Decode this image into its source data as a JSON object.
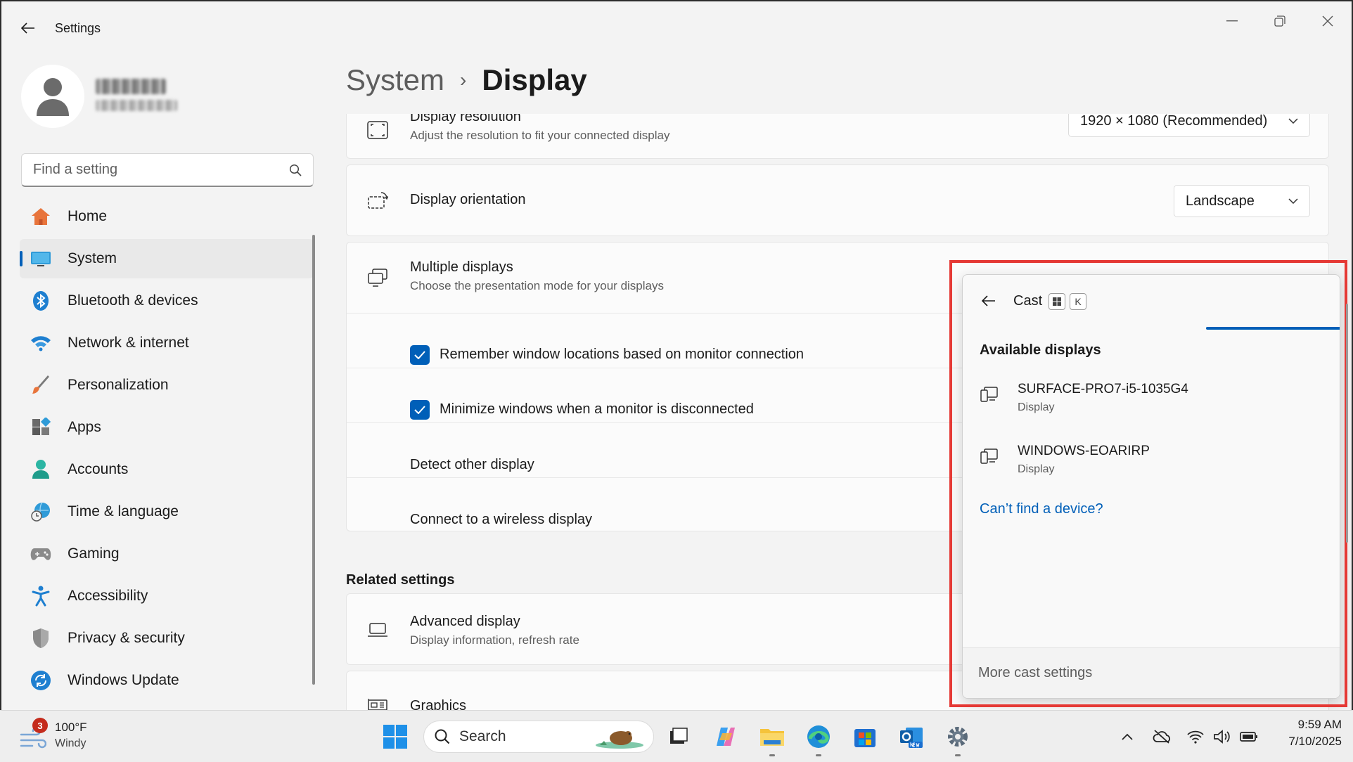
{
  "window": {
    "title": "Settings"
  },
  "search": {
    "placeholder": "Find a setting"
  },
  "nav": {
    "items": [
      {
        "label": "Home"
      },
      {
        "label": "System"
      },
      {
        "label": "Bluetooth & devices"
      },
      {
        "label": "Network & internet"
      },
      {
        "label": "Personalization"
      },
      {
        "label": "Apps"
      },
      {
        "label": "Accounts"
      },
      {
        "label": "Time & language"
      },
      {
        "label": "Gaming"
      },
      {
        "label": "Accessibility"
      },
      {
        "label": "Privacy & security"
      },
      {
        "label": "Windows Update"
      }
    ]
  },
  "breadcrumb": {
    "parent": "System",
    "separator": "›",
    "current": "Display"
  },
  "display": {
    "resolution": {
      "title": "Display resolution",
      "desc": "Adjust the resolution to fit your connected display",
      "value": "1920 × 1080 (Recommended)"
    },
    "orientation": {
      "title": "Display orientation",
      "value": "Landscape"
    },
    "multiple": {
      "title": "Multiple displays",
      "desc": "Choose the presentation mode for your displays",
      "remember_label": "Remember window locations based on monitor connection",
      "minimize_label": "Minimize windows when a monitor is disconnected",
      "detect_label": "Detect other display",
      "wireless_label": "Connect to a wireless display"
    }
  },
  "related": {
    "title": "Related settings",
    "advanced": {
      "title": "Advanced display",
      "desc": "Display information, refresh rate"
    },
    "graphics": {
      "title": "Graphics"
    }
  },
  "cast": {
    "title": "Cast",
    "shortcut_key": "K",
    "available_heading": "Available displays",
    "devices": [
      {
        "name": "SURFACE-PRO7-i5-1035G4",
        "type": "Display"
      },
      {
        "name": "WINDOWS-EOARIRP",
        "type": "Display"
      }
    ],
    "help_link": "Can’t find a device?",
    "more_settings": "More cast settings"
  },
  "taskbar": {
    "weather_badge": "3",
    "weather_temp": "100°F",
    "weather_cond": "Windy",
    "search_label": "Search",
    "time": "9:59 AM",
    "date": "7/10/2025"
  },
  "colors": {
    "accent": "#005fb8",
    "highlight_box": "#e53935"
  }
}
